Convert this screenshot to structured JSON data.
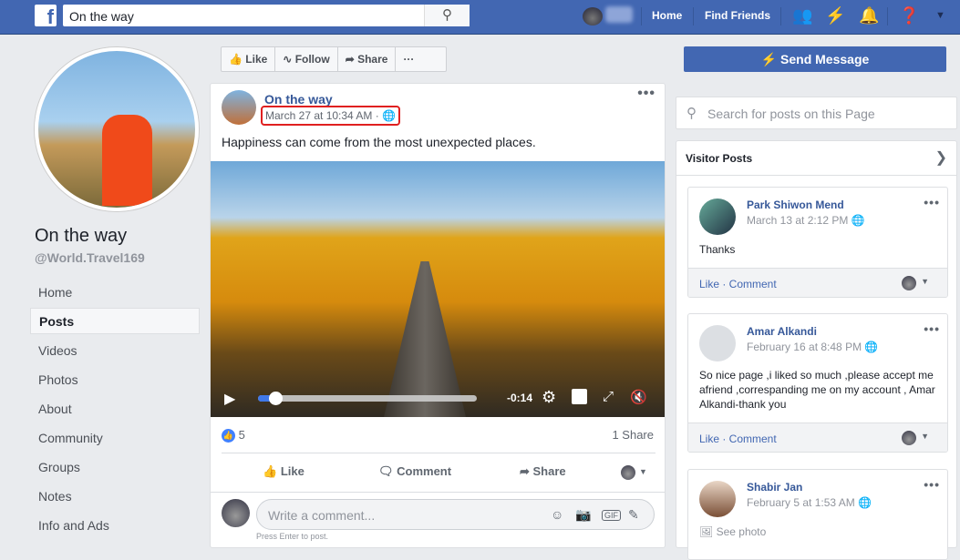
{
  "topbar": {
    "search_value": "On the way",
    "nav": [
      "Home",
      "Find Friends"
    ]
  },
  "page": {
    "name": "On the way",
    "handle": "@World.Travel169",
    "nav": [
      "Home",
      "Posts",
      "Videos",
      "Photos",
      "About",
      "Community",
      "Groups",
      "Notes",
      "Info and Ads"
    ],
    "active_nav": "Posts"
  },
  "actions": {
    "like": "Like",
    "follow": "Follow",
    "share": "Share",
    "more": "···",
    "send_message": "Send Message"
  },
  "post": {
    "author": "On the way",
    "date": "March 27 at 10:34 AM · ",
    "text": "Happiness can come from the most unexpected places.",
    "video": {
      "time_remaining": "-0:14",
      "progress": 0.08
    },
    "likes": "5",
    "shares": "1 Share",
    "buttons": [
      "Like",
      "Comment",
      "Share"
    ],
    "comment_placeholder": "Write a comment...",
    "hint": "Press Enter to post."
  },
  "sidebar": {
    "search_placeholder": "Search for posts on this Page",
    "visitor_title": "Visitor Posts",
    "posts": [
      {
        "name": "Park Shiwon Mend",
        "date": "March 13 at 2:12 PM",
        "text": "Thanks",
        "actions": "Like · Comment"
      },
      {
        "name": "Amar Alkandi",
        "date": "February 16 at 8:48 PM",
        "text": "So nice page ,i liked so much ,please accept me afriend ,correspanding me on my account , Amar Alkandi-thank you",
        "actions": "Like · Comment"
      },
      {
        "name": "Shabir Jan",
        "date": "February 5 at 1:53 AM",
        "text": "See photo"
      }
    ]
  },
  "colors": {
    "brand": "#4267b2",
    "link": "#365899",
    "highlight": "#e02020"
  }
}
